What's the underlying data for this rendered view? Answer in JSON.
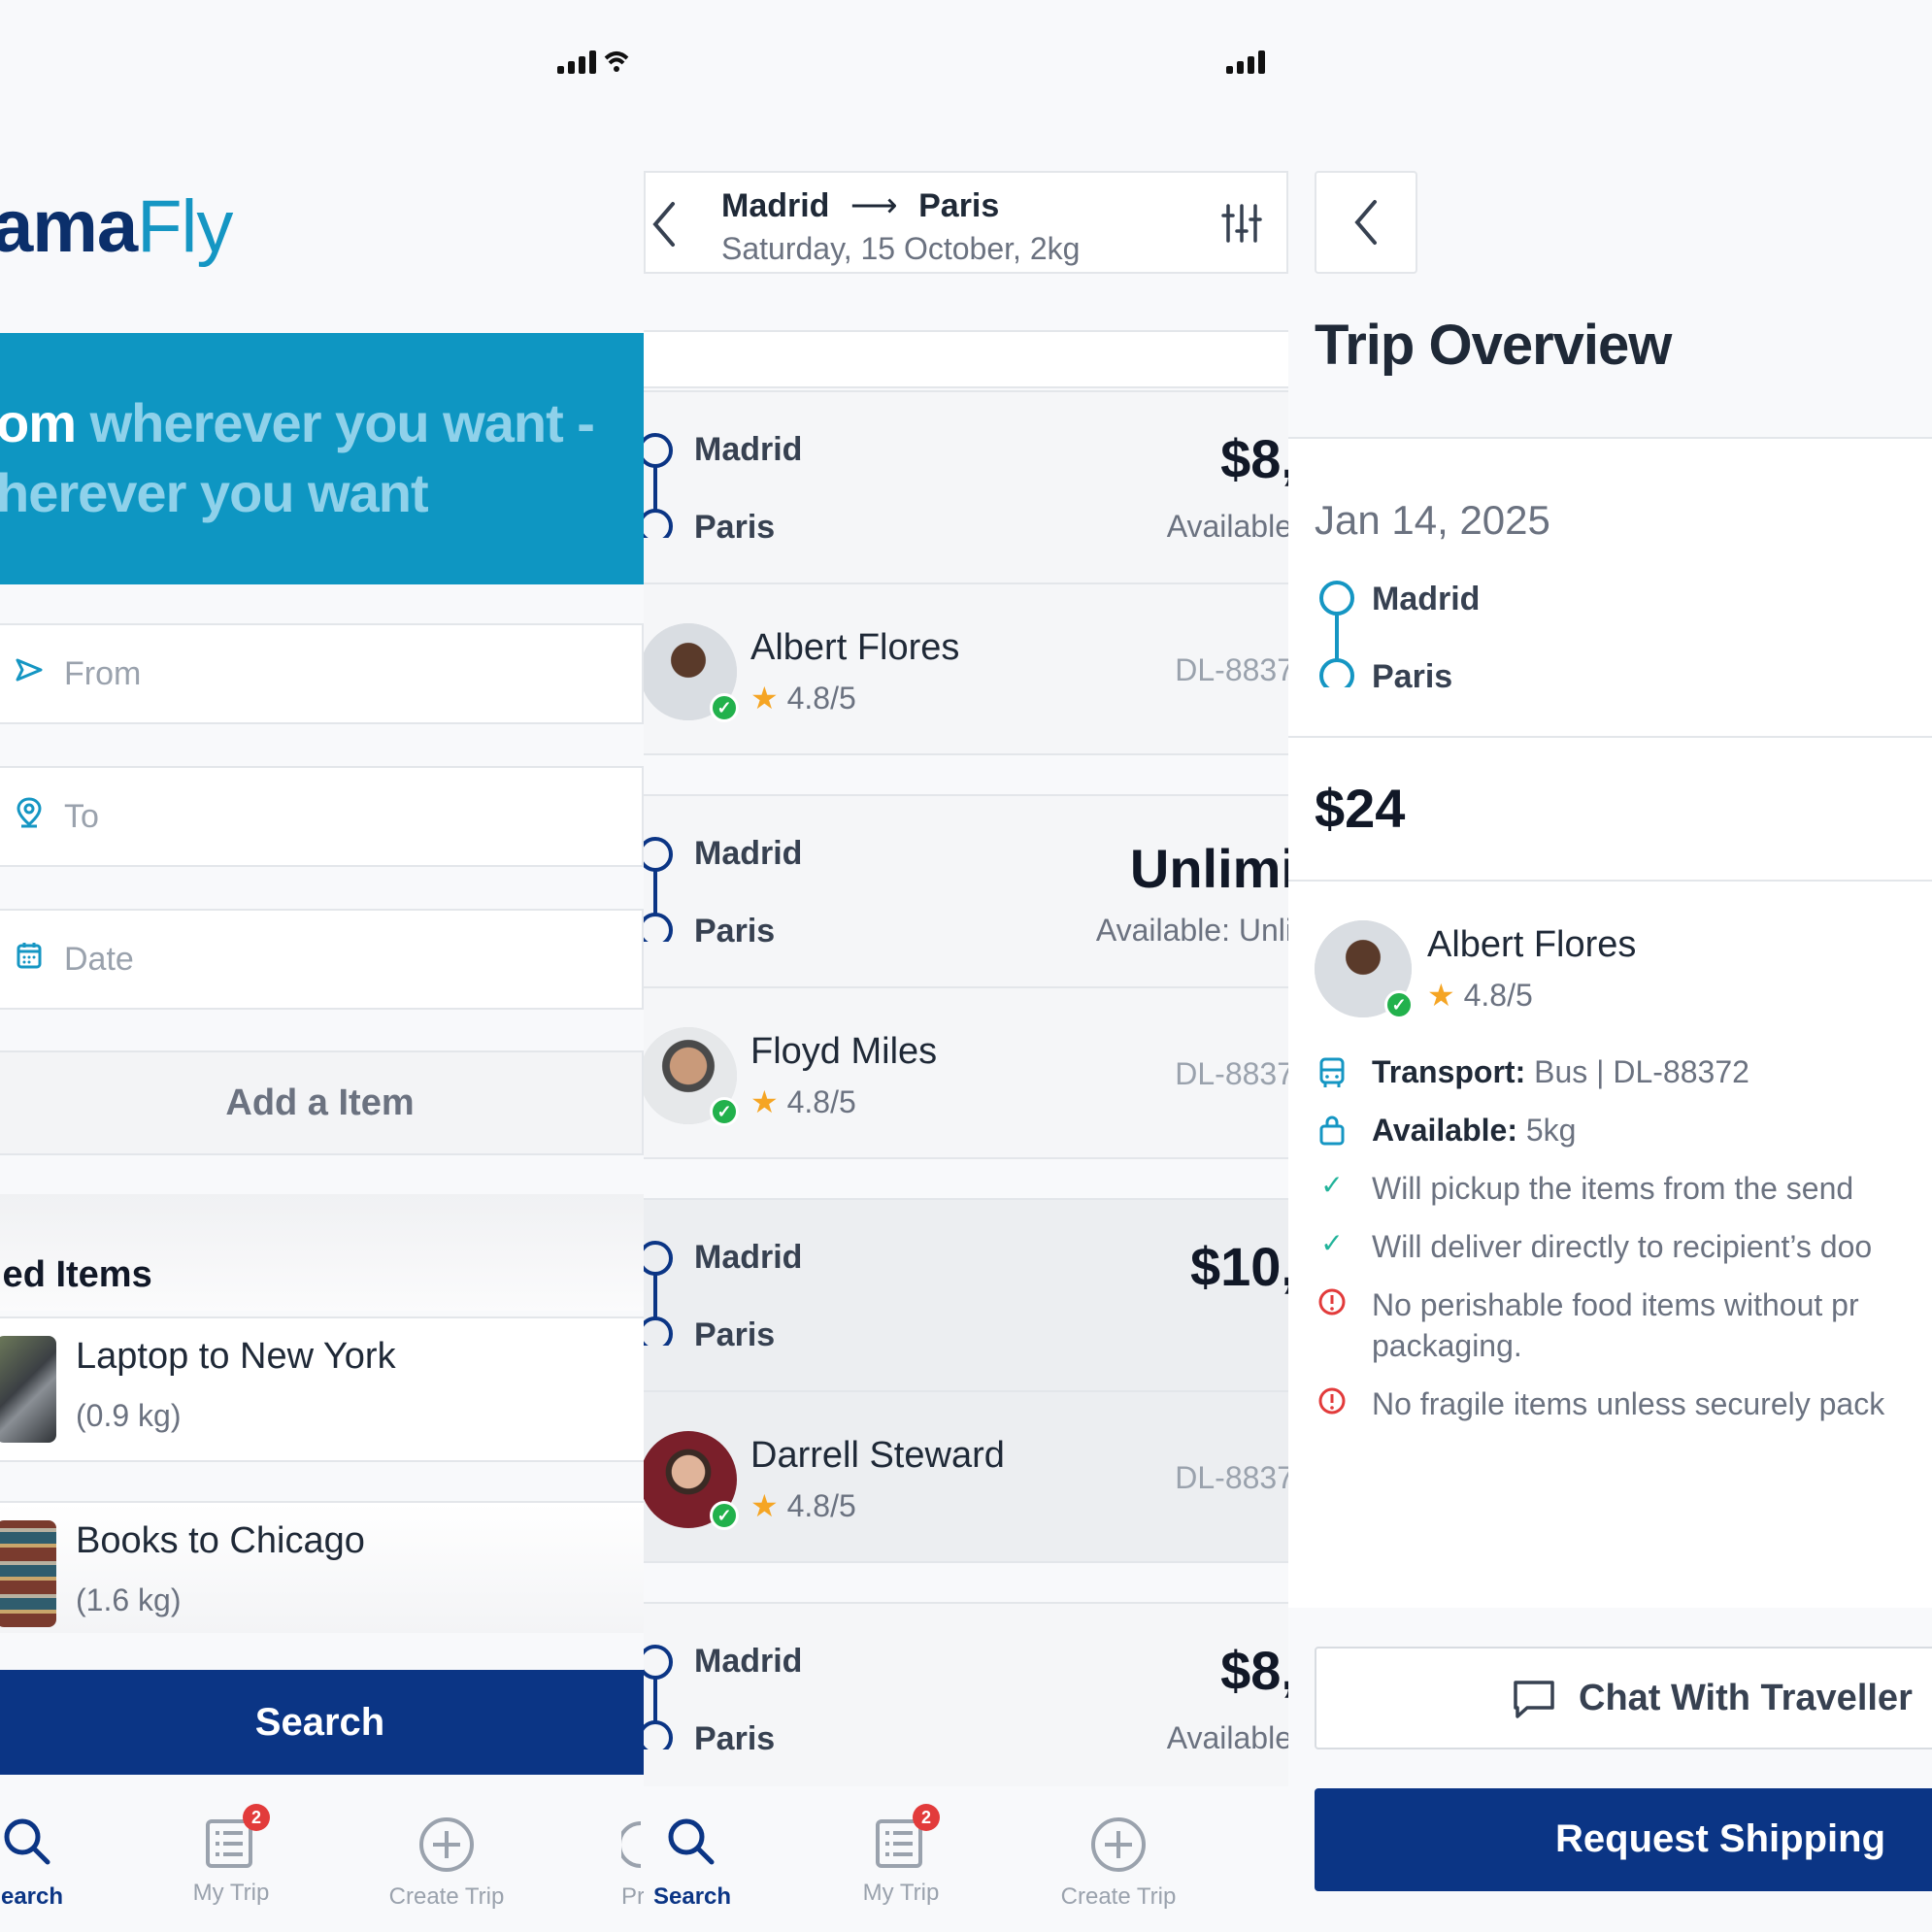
{
  "colors": {
    "primary": "#0b3585",
    "accent": "#1596c3",
    "success": "#22b14c",
    "warning": "#e23b3b",
    "star": "#f5a524"
  },
  "screen1": {
    "logo_bold": "ama",
    "logo_light": "Fly",
    "hero_line1_white": "om",
    "hero_line1_cyan": "wherever you want -",
    "hero_line2": "herever you want",
    "from_placeholder": "From",
    "to_placeholder": "To",
    "date_placeholder": "Date",
    "add_item_label": "Add a Item",
    "added_items_title": "led Items",
    "items": [
      {
        "title": "Laptop to New York",
        "weight": "(0.9 kg)"
      },
      {
        "title": "Books to Chicago",
        "weight": "(1.6 kg)"
      }
    ],
    "search_label": "Search",
    "tabs": [
      {
        "label": "earch",
        "icon": "search-icon",
        "active": true
      },
      {
        "label": "My Trip",
        "icon": "list-icon",
        "badge": "2"
      },
      {
        "label": "Create Trip",
        "icon": "plus-circle-icon"
      },
      {
        "label": "Pr",
        "icon": "profile-icon"
      }
    ]
  },
  "screen2": {
    "route_from": "Madrid",
    "route_to": "Paris",
    "route_arrow": "⟶",
    "route_details": "Saturday, 15 October, 2kg",
    "trips": [
      {
        "from": "Madrid",
        "to": "Paris",
        "price": "$8,",
        "available": "Available",
        "traveller": "Albert Flores",
        "rating": "4.8/5",
        "code": "DL-8837"
      },
      {
        "from": "Madrid",
        "to": "Paris",
        "price": "Unlimi",
        "available": "Available: Unli",
        "traveller": "Floyd Miles",
        "rating": "4.8/5",
        "code": "DL-8837"
      },
      {
        "from": "Madrid",
        "to": "Paris",
        "price": "$10,",
        "available": "",
        "traveller": "Darrell Steward",
        "rating": "4.8/5",
        "code": "DL-8837"
      },
      {
        "from": "Madrid",
        "to": "Paris",
        "price": "$8,",
        "available": "Available"
      }
    ],
    "tabs": [
      {
        "label": "Search",
        "icon": "search-icon",
        "active": true
      },
      {
        "label": "My Trip",
        "icon": "list-icon",
        "badge": "2"
      },
      {
        "label": "Create Trip",
        "icon": "plus-circle-icon"
      }
    ]
  },
  "screen3": {
    "title": "Trip Overview",
    "date": "Jan 14, 2025",
    "from": "Madrid",
    "to": "Paris",
    "price": "$24",
    "traveller": "Albert Flores",
    "rating": "4.8/5",
    "transport_label": "Transport:",
    "transport_value": " Bus | DL-88372",
    "available_label": "Available:",
    "available_value": " 5kg",
    "notes": [
      {
        "type": "check",
        "text": "Will pickup the items from the send"
      },
      {
        "type": "check",
        "text": "Will deliver directly to recipient’s doo"
      },
      {
        "type": "warn",
        "text": "No perishable food items without pr"
      },
      {
        "type": "warn-cont",
        "text": "packaging."
      },
      {
        "type": "warn",
        "text": "No fragile items unless securely pack"
      }
    ],
    "chat_label": "Chat With Traveller",
    "request_label": "Request Shipping"
  }
}
